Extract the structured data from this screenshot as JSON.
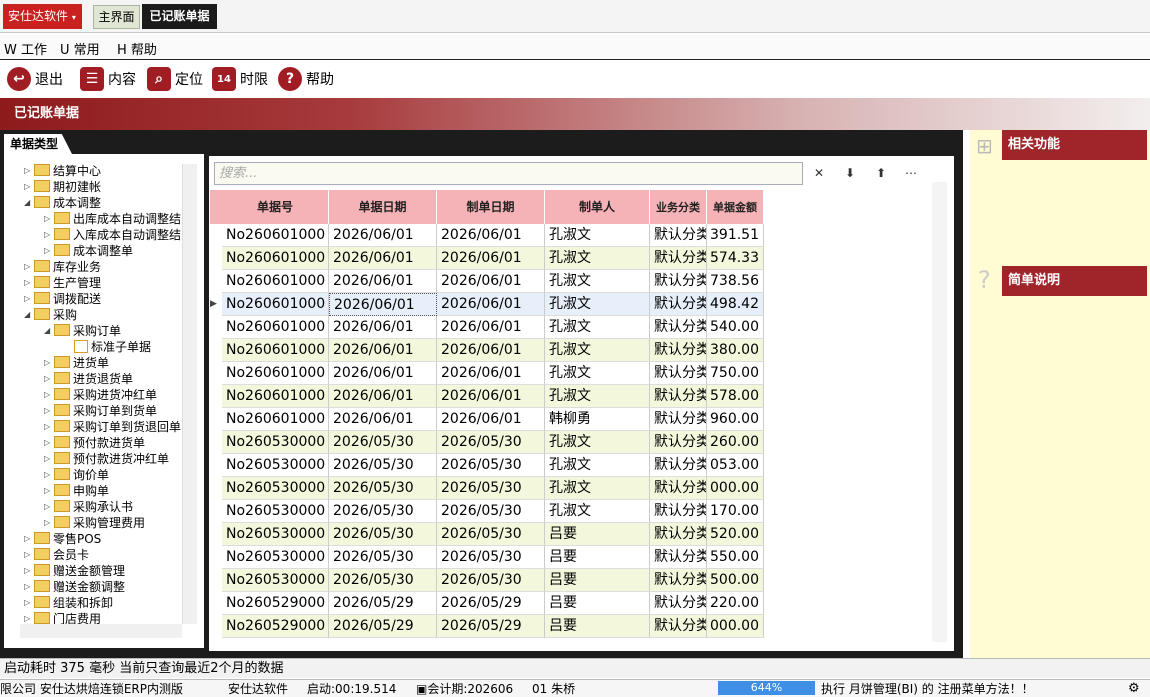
{
  "app": {
    "brand": "安仕达软件",
    "tabs": [
      "主界面",
      "已记账单据"
    ]
  },
  "menu": [
    "W 工作",
    "U 常用",
    "H 帮助"
  ],
  "toolbar": [
    {
      "label": "退出",
      "icon": "exit-icon"
    },
    {
      "label": "内容",
      "icon": "content-icon"
    },
    {
      "label": "定位",
      "icon": "locate-icon"
    },
    {
      "label": "时限",
      "icon": "calendar-icon"
    },
    {
      "label": "帮助",
      "icon": "help-icon"
    }
  ],
  "banner_title": "已记账单据",
  "left_panel": {
    "title": "单据类型",
    "tree": [
      {
        "label": "结算中心",
        "level": 0,
        "expanded": false,
        "type": "folder"
      },
      {
        "label": "期初建帐",
        "level": 0,
        "expanded": false,
        "type": "folder"
      },
      {
        "label": "成本调整",
        "level": 0,
        "expanded": true,
        "type": "folder"
      },
      {
        "label": "出库成本自动调整结",
        "level": 1,
        "expanded": false,
        "type": "folder"
      },
      {
        "label": "入库成本自动调整结",
        "level": 1,
        "expanded": false,
        "type": "folder"
      },
      {
        "label": "成本调整单",
        "level": 1,
        "expanded": false,
        "type": "folder"
      },
      {
        "label": "库存业务",
        "level": 0,
        "expanded": false,
        "type": "folder"
      },
      {
        "label": "生产管理",
        "level": 0,
        "expanded": false,
        "type": "folder"
      },
      {
        "label": "调拨配送",
        "level": 0,
        "expanded": false,
        "type": "folder"
      },
      {
        "label": "采购",
        "level": 0,
        "expanded": true,
        "type": "folder"
      },
      {
        "label": "采购订单",
        "level": 1,
        "expanded": true,
        "type": "folder"
      },
      {
        "label": "标准子单据",
        "level": 2,
        "expanded": false,
        "type": "doc"
      },
      {
        "label": "进货单",
        "level": 1,
        "expanded": false,
        "type": "folder"
      },
      {
        "label": "进货退货单",
        "level": 1,
        "expanded": false,
        "type": "folder"
      },
      {
        "label": "采购进货冲红单",
        "level": 1,
        "expanded": false,
        "type": "folder"
      },
      {
        "label": "采购订单到货单",
        "level": 1,
        "expanded": false,
        "type": "folder"
      },
      {
        "label": "采购订单到货退回单",
        "level": 1,
        "expanded": false,
        "type": "folder"
      },
      {
        "label": "预付款进货单",
        "level": 1,
        "expanded": false,
        "type": "folder"
      },
      {
        "label": "预付款进货冲红单",
        "level": 1,
        "expanded": false,
        "type": "folder"
      },
      {
        "label": "询价单",
        "level": 1,
        "expanded": false,
        "type": "folder"
      },
      {
        "label": "申购单",
        "level": 1,
        "expanded": false,
        "type": "folder"
      },
      {
        "label": "采购承认书",
        "level": 1,
        "expanded": false,
        "type": "folder"
      },
      {
        "label": "采购管理费用",
        "level": 1,
        "expanded": false,
        "type": "folder"
      },
      {
        "label": "零售POS",
        "level": 0,
        "expanded": false,
        "type": "folder"
      },
      {
        "label": "会员卡",
        "level": 0,
        "expanded": false,
        "type": "folder"
      },
      {
        "label": "赠送金额管理",
        "level": 0,
        "expanded": false,
        "type": "folder"
      },
      {
        "label": "赠送金额调整",
        "level": 0,
        "expanded": false,
        "type": "folder"
      },
      {
        "label": "组装和拆卸",
        "level": 0,
        "expanded": false,
        "type": "folder"
      },
      {
        "label": "门店费用",
        "level": 0,
        "expanded": false,
        "type": "folder"
      }
    ]
  },
  "grid": {
    "search_placeholder": "搜索...",
    "buttons": [
      "✕",
      "⬇",
      "⬆",
      "⋯"
    ],
    "columns": [
      "单据号",
      "单据日期",
      "制单日期",
      "制单人",
      "业务分类",
      "单据金额"
    ],
    "rows": [
      [
        "No260601000",
        "2026/06/01",
        "2026/06/01",
        "孔淑文",
        "默认分类",
        "391.51"
      ],
      [
        "No260601000",
        "2026/06/01",
        "2026/06/01",
        "孔淑文",
        "默认分类",
        "574.33"
      ],
      [
        "No260601000",
        "2026/06/01",
        "2026/06/01",
        "孔淑文",
        "默认分类",
        "738.56"
      ],
      [
        "No260601000",
        "2026/06/01",
        "2026/06/01",
        "孔淑文",
        "默认分类",
        "498.42"
      ],
      [
        "No260601000",
        "2026/06/01",
        "2026/06/01",
        "孔淑文",
        "默认分类",
        "540.00"
      ],
      [
        "No260601000",
        "2026/06/01",
        "2026/06/01",
        "孔淑文",
        "默认分类",
        "380.00"
      ],
      [
        "No260601000",
        "2026/06/01",
        "2026/06/01",
        "孔淑文",
        "默认分类",
        "750.00"
      ],
      [
        "No260601000",
        "2026/06/01",
        "2026/06/01",
        "孔淑文",
        "默认分类",
        "578.00"
      ],
      [
        "No260601000",
        "2026/06/01",
        "2026/06/01",
        "韩柳勇",
        "默认分类",
        "960.00"
      ],
      [
        "No260530000",
        "2026/05/30",
        "2026/05/30",
        "孔淑文",
        "默认分类",
        "260.00"
      ],
      [
        "No260530000",
        "2026/05/30",
        "2026/05/30",
        "孔淑文",
        "默认分类",
        "053.00"
      ],
      [
        "No260530000",
        "2026/05/30",
        "2026/05/30",
        "孔淑文",
        "默认分类",
        "000.00"
      ],
      [
        "No260530000",
        "2026/05/30",
        "2026/05/30",
        "孔淑文",
        "默认分类",
        "170.00"
      ],
      [
        "No260530000",
        "2026/05/30",
        "2026/05/30",
        "吕要",
        "默认分类",
        "520.00"
      ],
      [
        "No260530000",
        "2026/05/30",
        "2026/05/30",
        "吕要",
        "默认分类",
        "550.00"
      ],
      [
        "No260530000",
        "2026/05/30",
        "2026/05/30",
        "吕要",
        "默认分类",
        "500.00"
      ],
      [
        "No260529000",
        "2026/05/29",
        "2026/05/29",
        "吕要",
        "默认分类",
        "220.00"
      ],
      [
        "No260529000",
        "2026/05/29",
        "2026/05/29",
        "吕要",
        "默认分类",
        "000.00"
      ]
    ],
    "selected_row": 3
  },
  "right_panel": {
    "related_title": "相关功能",
    "desc_title": "简单说明"
  },
  "status": {
    "line1": "启动耗时 375 毫秒 当前只查询最近2个月的数据",
    "company": "限公司 安仕达烘焙连锁ERP内测版",
    "product": "安仕达软件",
    "uptime": "启动:00:19.514",
    "period": "会计期:202606",
    "user": "01 朱桥",
    "progress_text": "644%",
    "message": "执行 月饼管理(BI) 的 注册菜单方法！！"
  },
  "colors": {
    "brand_red": "#c8211f",
    "header_pink": "#f6b3b7",
    "row_alt": "#f3f8dc",
    "side_yellow": "#fffbd2"
  }
}
